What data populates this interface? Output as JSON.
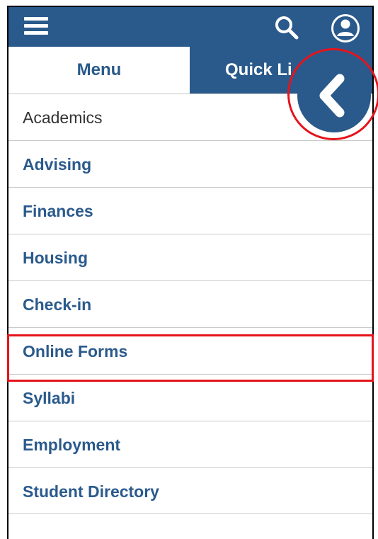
{
  "header": {
    "menu_icon": "hamburger-icon",
    "search_icon": "search-icon",
    "user_icon": "user-account-icon",
    "background_color": "#2a5a8c"
  },
  "tabs": [
    {
      "label": "Menu",
      "active": true
    },
    {
      "label": "Quick Li",
      "active": false
    }
  ],
  "menu": {
    "items": [
      {
        "label": "Academics"
      },
      {
        "label": "Advising"
      },
      {
        "label": "Finances"
      },
      {
        "label": "Housing"
      },
      {
        "label": "Check-in"
      },
      {
        "label": "Online Forms",
        "highlighted": true
      },
      {
        "label": "Syllabi"
      },
      {
        "label": "Employment"
      },
      {
        "label": "Student Directory"
      }
    ]
  },
  "back_button": {
    "icon": "chevron-left-icon"
  },
  "colors": {
    "brand": "#2a5a8c",
    "highlight": "#e5141c",
    "divider": "#c9c9c9"
  }
}
